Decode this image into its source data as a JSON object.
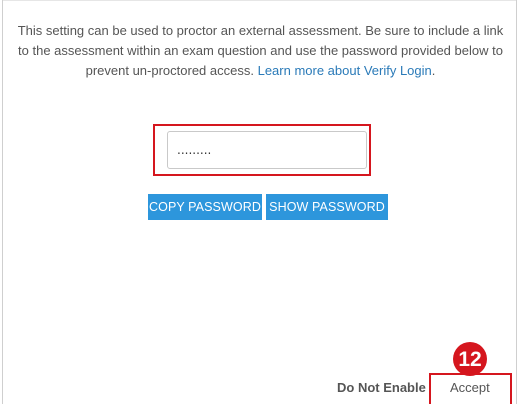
{
  "description": {
    "text": "This setting can be used to proctor an external assessment. Be sure to include a link to the assessment within an exam question and use the password provided below to prevent un-proctored access. ",
    "link_text": "Learn more about Verify Login",
    "trailing": "."
  },
  "password_field": {
    "value": "........."
  },
  "buttons": {
    "copy_password": "COPY PASSWORD",
    "show_password": "SHOW PASSWORD"
  },
  "footer": {
    "do_not_enable": "Do Not Enable",
    "accept": "Accept"
  },
  "annotation": {
    "step_number": "12",
    "highlight_color": "#d5161e"
  },
  "colors": {
    "primary_button": "#2d96dc",
    "link": "#2a7ab8",
    "text": "#555555"
  }
}
